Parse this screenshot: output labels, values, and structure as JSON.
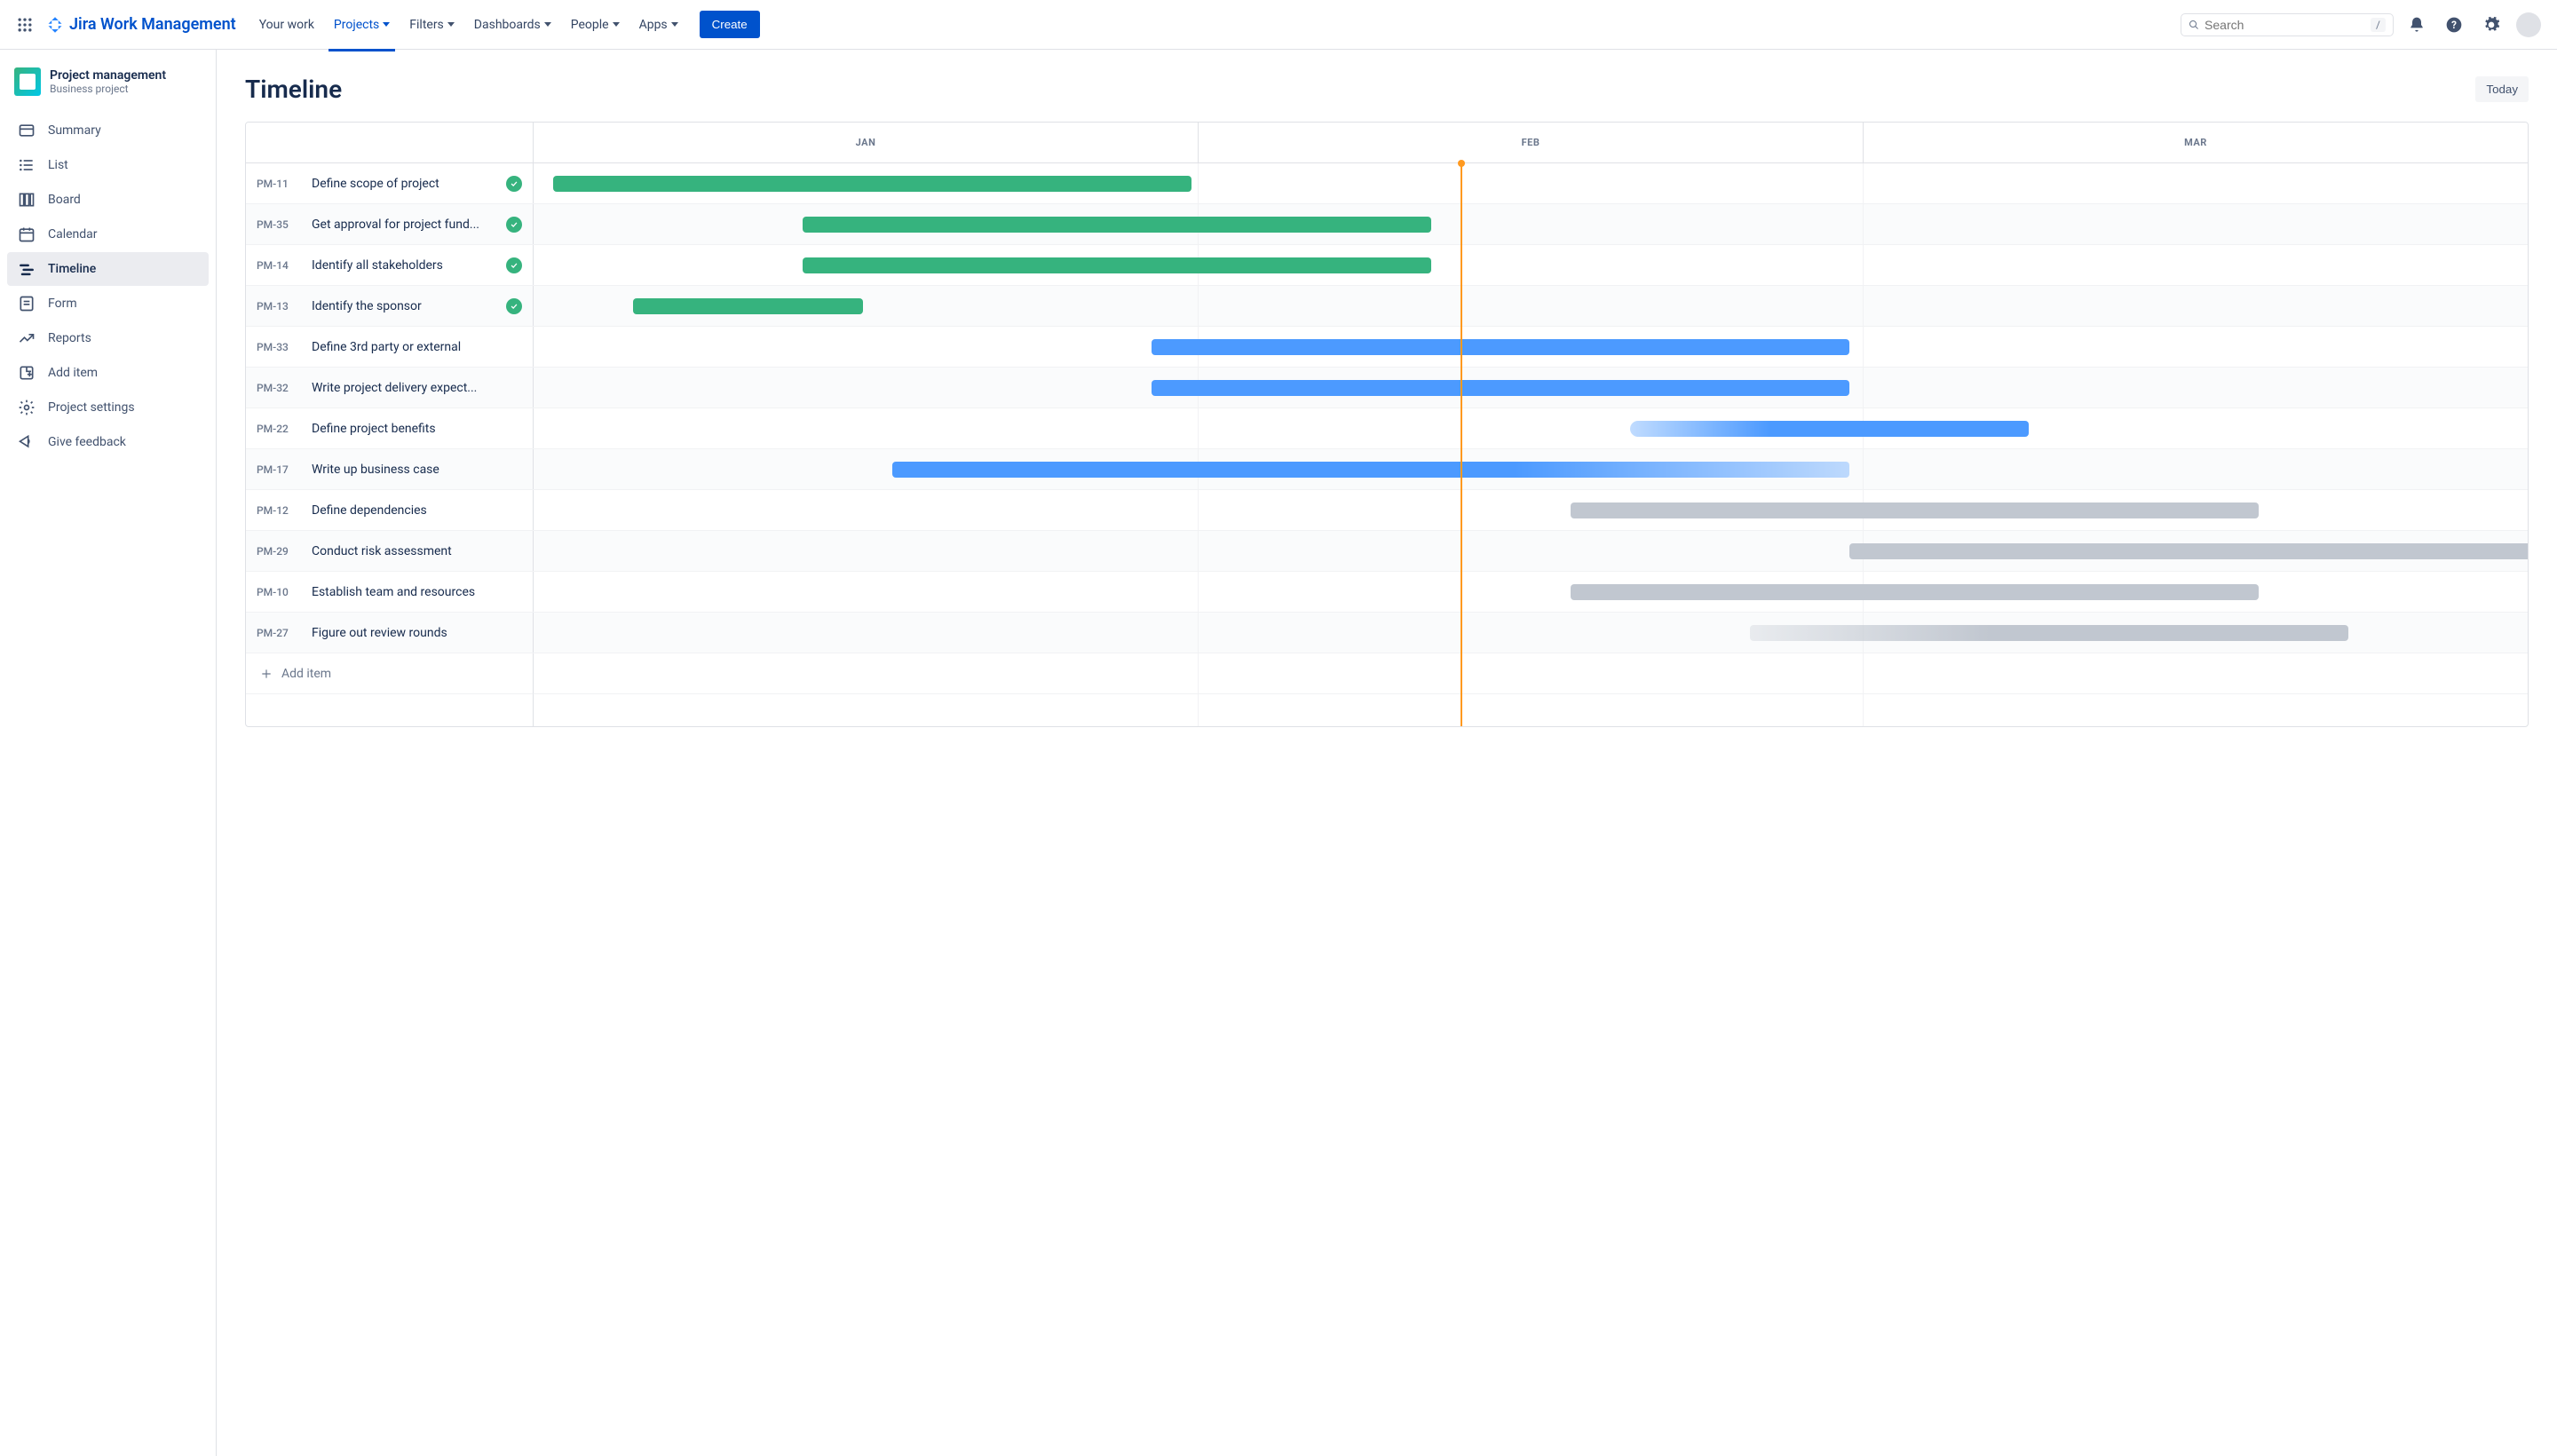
{
  "app": {
    "product_name": "Jira Work Management"
  },
  "topnav": {
    "items": [
      "Your work",
      "Projects",
      "Filters",
      "Dashboards",
      "People",
      "Apps"
    ],
    "active_index": 1,
    "create_label": "Create",
    "search_placeholder": "Search",
    "slash_hint": "/"
  },
  "sidebar": {
    "project_name": "Project management",
    "project_type": "Business project",
    "items": [
      {
        "label": "Summary",
        "icon": "summary"
      },
      {
        "label": "List",
        "icon": "list"
      },
      {
        "label": "Board",
        "icon": "board"
      },
      {
        "label": "Calendar",
        "icon": "calendar"
      },
      {
        "label": "Timeline",
        "icon": "timeline"
      },
      {
        "label": "Form",
        "icon": "form"
      },
      {
        "label": "Reports",
        "icon": "reports"
      },
      {
        "label": "Add item",
        "icon": "add-item"
      },
      {
        "label": "Project settings",
        "icon": "settings"
      },
      {
        "label": "Give feedback",
        "icon": "feedback"
      }
    ],
    "active_index": 4
  },
  "page": {
    "title": "Timeline",
    "today_label": "Today"
  },
  "timeline": {
    "months": [
      "JAN",
      "FEB",
      "MAR"
    ],
    "today_position_pct": 46.5,
    "add_item_label": "Add item",
    "tasks": [
      {
        "key": "PM-11",
        "title": "Define scope of project",
        "done": true,
        "bar": {
          "start": 1,
          "width": 32,
          "style": "green"
        }
      },
      {
        "key": "PM-35",
        "title": "Get approval for project fund...",
        "done": true,
        "bar": {
          "start": 13.5,
          "width": 31.5,
          "style": "green"
        }
      },
      {
        "key": "PM-14",
        "title": "Identify all stakeholders",
        "done": true,
        "bar": {
          "start": 13.5,
          "width": 31.5,
          "style": "green"
        }
      },
      {
        "key": "PM-13",
        "title": "Identify the sponsor",
        "done": true,
        "bar": {
          "start": 5,
          "width": 11.5,
          "style": "green"
        }
      },
      {
        "key": "PM-33",
        "title": "Define 3rd party or external",
        "done": false,
        "bar": {
          "start": 31,
          "width": 35,
          "style": "blue"
        }
      },
      {
        "key": "PM-32",
        "title": "Write project delivery expect...",
        "done": false,
        "bar": {
          "start": 31,
          "width": 35,
          "style": "blue"
        }
      },
      {
        "key": "PM-22",
        "title": "Define project benefits",
        "done": false,
        "bar": {
          "start": 55,
          "width": 20,
          "style": "blue-grad-rev"
        }
      },
      {
        "key": "PM-17",
        "title": "Write up business case",
        "done": false,
        "bar": {
          "start": 18,
          "width": 48,
          "style": "blue-grad"
        }
      },
      {
        "key": "PM-12",
        "title": "Define dependencies",
        "done": false,
        "bar": {
          "start": 52,
          "width": 34.5,
          "style": "grey"
        }
      },
      {
        "key": "PM-29",
        "title": "Conduct risk assessment",
        "done": false,
        "bar": {
          "start": 66,
          "width": 34.5,
          "style": "grey"
        }
      },
      {
        "key": "PM-10",
        "title": "Establish team and resources",
        "done": false,
        "bar": {
          "start": 52,
          "width": 34.5,
          "style": "grey"
        }
      },
      {
        "key": "PM-27",
        "title": "Figure out review rounds",
        "done": false,
        "bar": {
          "start": 61,
          "width": 30,
          "style": "grey-grad"
        }
      }
    ]
  }
}
